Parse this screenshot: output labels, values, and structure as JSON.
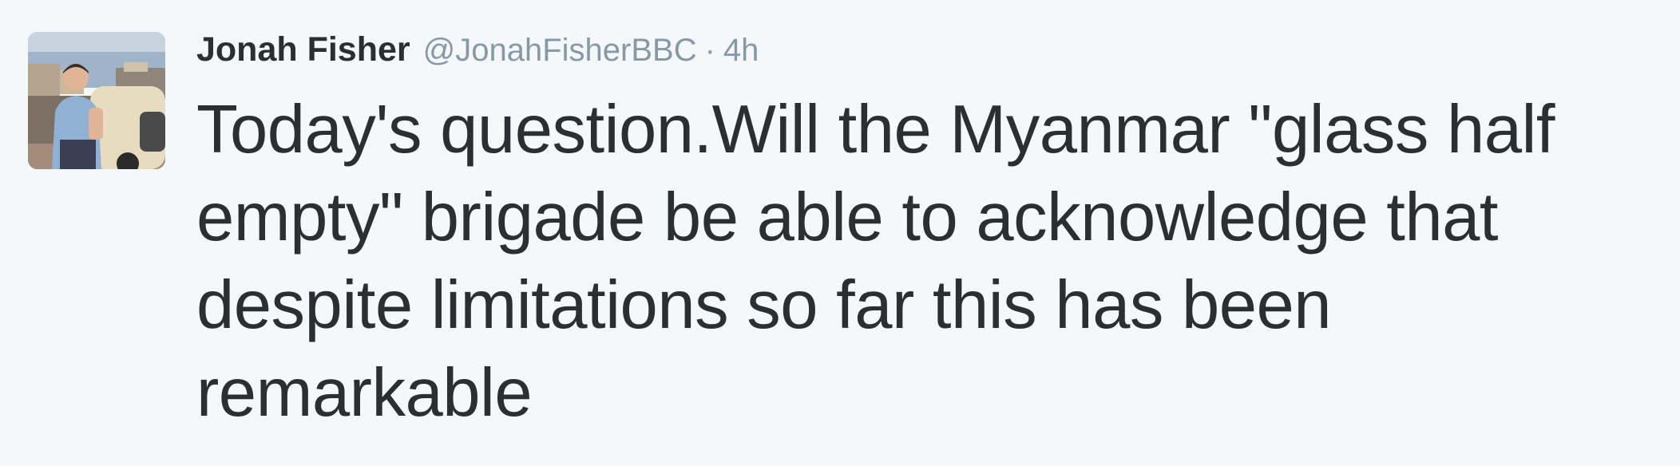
{
  "tweet": {
    "display_name": "Jonah Fisher",
    "handle": "@JonahFisherBBC",
    "separator": "·",
    "timestamp": "4h",
    "text": "Today's question.Will the Myanmar \"glass half empty\" brigade be able to acknowledge that despite limitations so far this has been remarkable"
  }
}
